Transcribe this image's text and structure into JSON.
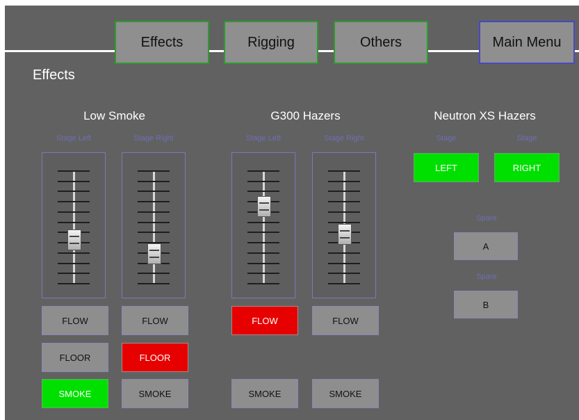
{
  "nav": {
    "effects": "Effects",
    "rigging": "Rigging",
    "others": "Others",
    "main_menu": "Main Menu"
  },
  "page_title": "Effects",
  "groups": {
    "low_smoke": {
      "title": "Low Smoke",
      "faders": [
        {
          "label": "Stage Left",
          "level": 0.38
        },
        {
          "label": "Stage Right",
          "level": 0.26
        }
      ],
      "buttons": {
        "left_flow": "FLOW",
        "right_flow": "FLOW",
        "left_floor": "FLOOR",
        "right_floor": "FLOOR",
        "left_smoke": "SMOKE",
        "right_smoke": "SMOKE"
      }
    },
    "g300": {
      "title": "G300 Hazers",
      "faders": [
        {
          "label": "Stage Left",
          "level": 0.68
        },
        {
          "label": "Stage Right",
          "level": 0.43
        }
      ],
      "buttons": {
        "left_flow": "FLOW",
        "right_flow": "FLOW",
        "left_smoke": "SMOKE",
        "right_smoke": "SMOKE"
      }
    },
    "neutron": {
      "title": "Neutron XS Hazers",
      "stage_left_label": "Stage",
      "stage_right_label": "Stage",
      "left_button": "LEFT",
      "right_button": "RIGHT",
      "spare_a_label": "Spare",
      "spare_a_button": "A",
      "spare_b_label": "Spare",
      "spare_b_button": "B"
    }
  },
  "colors": {
    "active_red": "#e60000",
    "active_green": "#00e000",
    "inactive_gray": "#8e8e8e",
    "background": "#616161"
  }
}
